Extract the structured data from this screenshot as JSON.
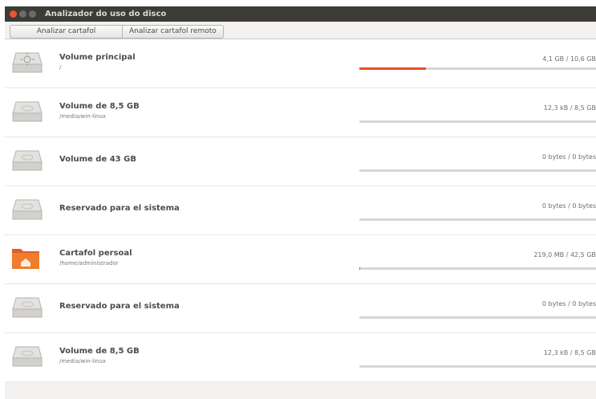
{
  "window": {
    "title": "Analizador do uso do disco"
  },
  "toolbar": {
    "analyze_folder": "Analizar cartafol",
    "analyze_remote": "Analizar cartafol remoto"
  },
  "volumes": [
    {
      "name": "Volume principal",
      "path": "/",
      "usage": "4,1 GB / 10,6 GB",
      "fraction": 0.28,
      "icon": "system-drive-icon"
    },
    {
      "name": "Volume de 8,5 GB",
      "path": "/media/win-linux",
      "usage": "12,3 kB / 8,5 GB",
      "fraction": 0,
      "icon": "drive-icon"
    },
    {
      "name": "Volume de 43 GB",
      "path": "",
      "usage": "0 bytes / 0 bytes",
      "fraction": 0,
      "icon": "drive-icon"
    },
    {
      "name": "Reservado para el sistema",
      "path": "",
      "usage": "0 bytes / 0 bytes",
      "fraction": 0,
      "icon": "drive-icon"
    },
    {
      "name": "Cartafol persoal",
      "path": "/home/administrador",
      "usage": "219,0 MB / 42,5 GB",
      "fraction": 0.005,
      "icon": "home-folder-icon"
    },
    {
      "name": "Reservado para el sistema",
      "path": "",
      "usage": "0 bytes / 0 bytes",
      "fraction": 0,
      "icon": "drive-icon"
    },
    {
      "name": "Volume de 8,5 GB",
      "path": "/media/win-linux",
      "usage": "12,3 kB / 8,5 GB",
      "fraction": 0,
      "icon": "drive-icon"
    }
  ],
  "colors": {
    "titlebar": "#3c3b37",
    "accent": "#e2532a",
    "folder": "#f07d2c"
  }
}
